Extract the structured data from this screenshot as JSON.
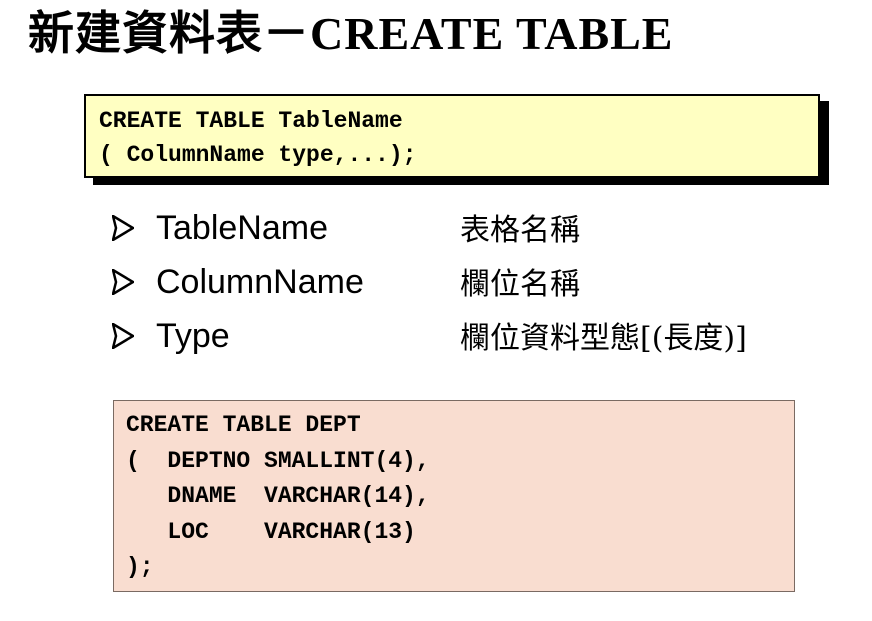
{
  "title": "新建資料表－CREATE TABLE",
  "syntax": {
    "lines": [
      "CREATE TABLE TableName",
      "( ColumnName type,...);"
    ]
  },
  "bullets": [
    {
      "term": "TableName",
      "desc": "表格名稱"
    },
    {
      "term": "ColumnName",
      "desc": "欄位名稱"
    },
    {
      "term": "Type",
      "desc": "欄位資料型態[(長度)]"
    }
  ],
  "example": {
    "lines": [
      "CREATE TABLE DEPT",
      "(  DEPTNO SMALLINT(4),",
      "   DNAME  VARCHAR(14),",
      "   LOC    VARCHAR(13)",
      ");"
    ]
  },
  "colors": {
    "syntax_background": "#ffffc2",
    "example_background": "#f9ddd0"
  },
  "icons": {
    "bullet": "arrowhead-bullet-icon"
  }
}
